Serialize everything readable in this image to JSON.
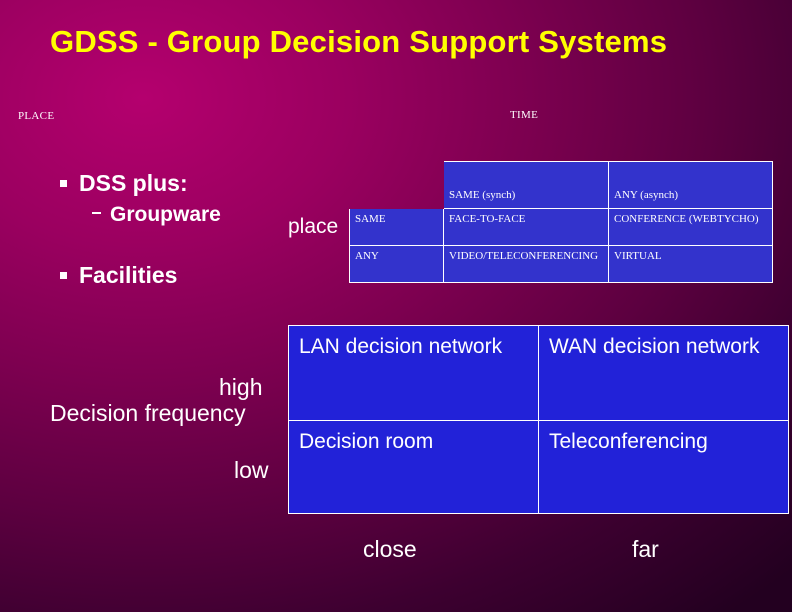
{
  "slide": {
    "title": "GDSS - Group Decision Support Systems",
    "place_axis_label": "PLACE",
    "time_axis_label": "TIME",
    "bullets": [
      {
        "level": 1,
        "text": "DSS plus:"
      },
      {
        "level": 2,
        "text": "Groupware"
      },
      {
        "level": 1,
        "text": "Facilities"
      }
    ],
    "place_word": "place",
    "top_matrix": {
      "header_row": [
        "",
        "SAME (synch)",
        "ANY (asynch)"
      ],
      "rows": [
        {
          "label": "SAME",
          "cells": [
            "FACE-TO-FACE",
            "CONFERENCE (WEBTYCHO)"
          ]
        },
        {
          "label": "ANY",
          "cells": [
            "VIDEO/TELECONFERENCING",
            "VIRTUAL"
          ]
        }
      ]
    },
    "bottom_matrix": {
      "row_axis_title": "Decision frequency",
      "row_labels": [
        "high",
        "low"
      ],
      "col_labels": [
        "close",
        "far"
      ],
      "rows": [
        [
          "LAN decision network",
          "WAN decision network"
        ],
        [
          "Decision room",
          "Teleconferencing"
        ]
      ]
    },
    "colors": {
      "title": "#ffff00",
      "text": "#ffffff",
      "table_top_fill": "#3333cc",
      "table_bottom_fill": "#2222d8"
    }
  }
}
